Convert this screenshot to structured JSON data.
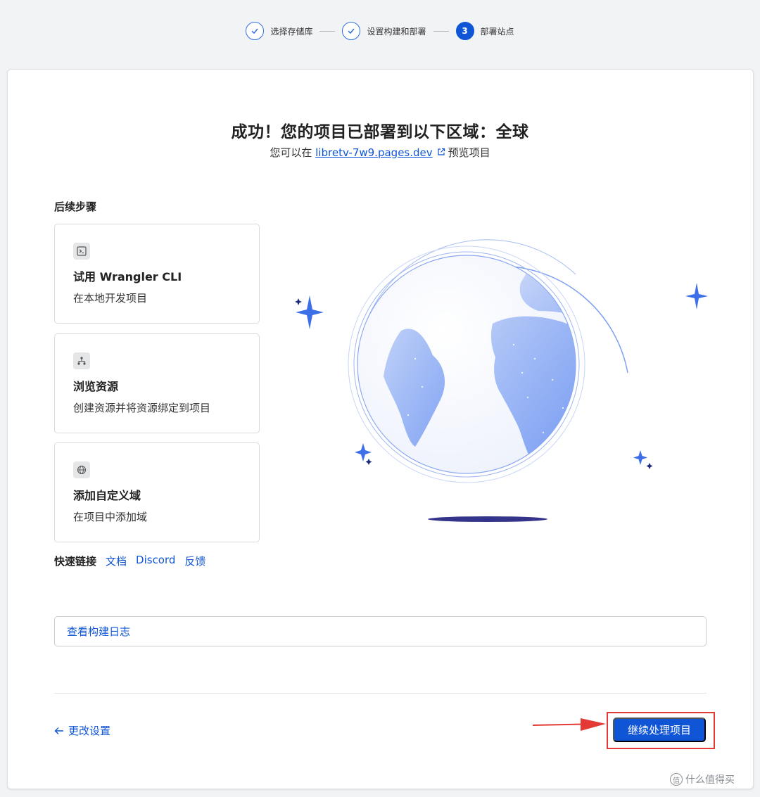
{
  "stepper": {
    "steps": [
      {
        "label": "选择存储库",
        "status": "done"
      },
      {
        "label": "设置构建和部署",
        "status": "done"
      },
      {
        "label": "部署站点",
        "status": "current",
        "number": "3"
      }
    ]
  },
  "header": {
    "title": "成功！您的项目已部署到以下区域：全球",
    "subtitle_prefix": "您可以在",
    "subtitle_link": "libretv-7w9.pages.dev",
    "subtitle_suffix": "预览项目"
  },
  "next_steps": {
    "label": "后续步骤",
    "items": [
      {
        "title": "试用 Wrangler CLI",
        "desc": "在本地开发项目",
        "icon": "terminal-icon"
      },
      {
        "title": "浏览资源",
        "desc": "创建资源并将资源绑定到项目",
        "icon": "hierarchy-icon"
      },
      {
        "title": "添加自定义域",
        "desc": "在项目中添加域",
        "icon": "globe-icon"
      }
    ]
  },
  "quick_links": {
    "label": "快速链接",
    "links": [
      "文档",
      "Discord",
      "反馈"
    ]
  },
  "logs_button": "查看构建日志",
  "footer": {
    "back_label": "更改设置",
    "continue_label": "继续处理项目"
  },
  "watermark": {
    "text": "什么值得买",
    "icon_text": "值"
  },
  "colors": {
    "accent": "#0f55d6",
    "highlight": "#e53935",
    "globe": "#6f96f2"
  }
}
